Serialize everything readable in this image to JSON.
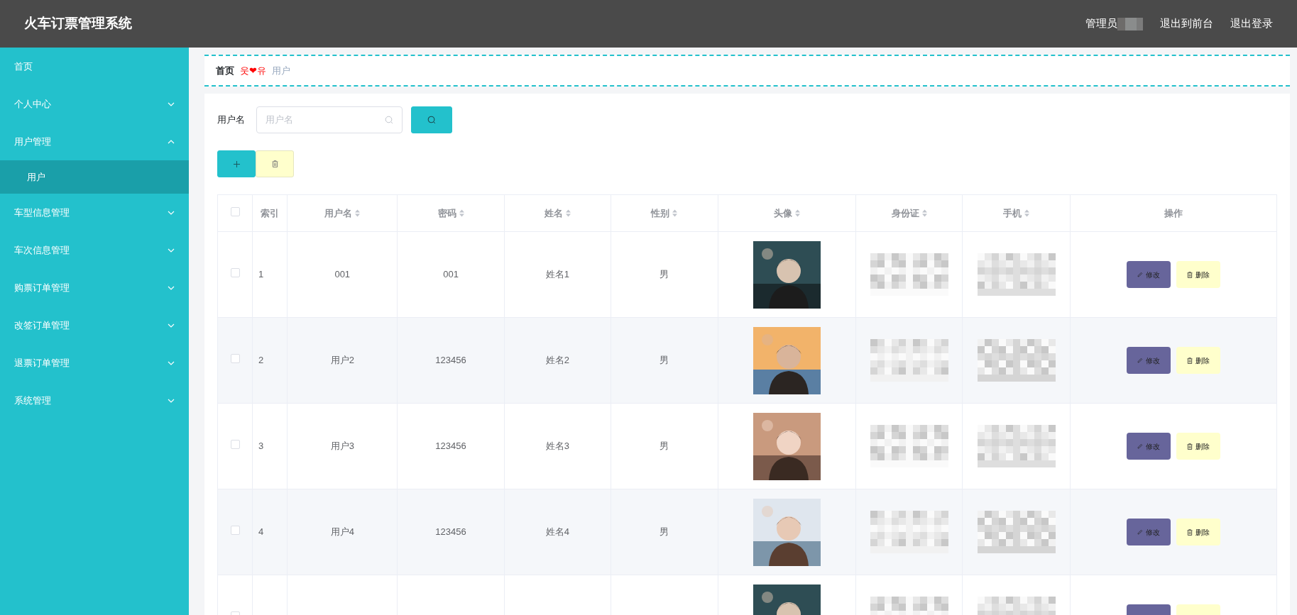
{
  "header": {
    "title": "火车订票管理系统",
    "user_label": "管理员",
    "links": [
      "退出到前台",
      "退出登录"
    ]
  },
  "sidebar": {
    "items": [
      {
        "label": "首页"
      },
      {
        "label": "个人中心",
        "expanded": false
      },
      {
        "label": "用户管理",
        "expanded": true,
        "children": [
          {
            "label": "用户",
            "selected": true
          }
        ]
      },
      {
        "label": "车型信息管理",
        "expanded": false
      },
      {
        "label": "车次信息管理",
        "expanded": false
      },
      {
        "label": "购票订单管理",
        "expanded": false
      },
      {
        "label": "改签订单管理",
        "expanded": false
      },
      {
        "label": "退票订单管理",
        "expanded": false
      },
      {
        "label": "系统管理",
        "expanded": false
      }
    ]
  },
  "breadcrumb": {
    "home": "首页",
    "separator": "웃❤유",
    "current": "用户"
  },
  "search": {
    "label": "用户名",
    "placeholder": "用户名"
  },
  "table": {
    "select_all": {
      "checked": false
    },
    "columns": [
      {
        "label": "索引",
        "sortable": false,
        "kind": "text"
      },
      {
        "label": "用户名",
        "sortable": true,
        "kind": "text"
      },
      {
        "label": "密码",
        "sortable": true,
        "kind": "text"
      },
      {
        "label": "姓名",
        "sortable": true,
        "kind": "text"
      },
      {
        "label": "性别",
        "sortable": true,
        "kind": "text"
      },
      {
        "label": "头像",
        "sortable": true,
        "kind": "picture"
      },
      {
        "label": "身份证",
        "sortable": true,
        "kind": "redacted"
      },
      {
        "label": "手机",
        "sortable": true,
        "kind": "redacted"
      },
      {
        "label": "操作",
        "sortable": false,
        "kind": "actions"
      }
    ],
    "rows": [
      {
        "checked": false,
        "cells": [
          "1",
          "001",
          "001",
          "姓名1",
          "男"
        ],
        "actions": [
          "修改",
          "删除"
        ]
      },
      {
        "checked": false,
        "cells": [
          "2",
          "用户2",
          "123456",
          "姓名2",
          "男"
        ],
        "actions": [
          "修改",
          "删除"
        ]
      },
      {
        "checked": false,
        "cells": [
          "3",
          "用户3",
          "123456",
          "姓名3",
          "男"
        ],
        "actions": [
          "修改",
          "删除"
        ]
      },
      {
        "checked": false,
        "cells": [
          "4",
          "用户4",
          "123456",
          "姓名4",
          "男"
        ],
        "actions": [
          "修改",
          "删除"
        ]
      },
      {
        "checked": false
      }
    ]
  }
}
